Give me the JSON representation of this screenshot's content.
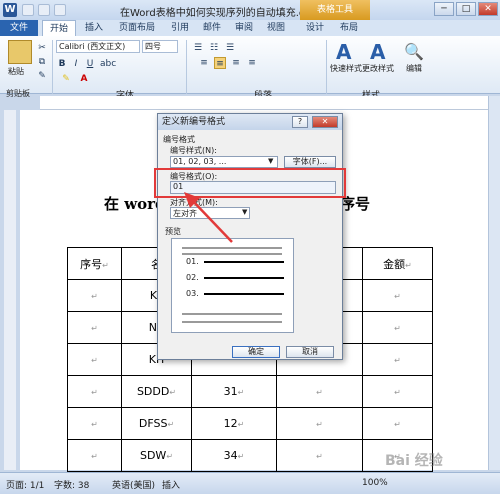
{
  "window": {
    "title": "在Word表格中如何实现序列的自动填充.docx M...",
    "table_tools": "表格工具",
    "min": "─",
    "max": "□",
    "close": "✕"
  },
  "tabs": [
    "文件",
    "开始",
    "插入",
    "页面布局",
    "引用",
    "邮件",
    "审阅",
    "视图",
    "设计",
    "布局"
  ],
  "ribbon": {
    "paste": "粘贴",
    "font_name": "Calibri (西文正文)",
    "font_size": "四号",
    "bold": "B",
    "italic": "I",
    "underline": "U",
    "quick_style": "快速样式",
    "change_style": "更改样式",
    "edit": "编辑",
    "groups": {
      "clipboard": "剪贴板",
      "font": "字体",
      "paragraph": "段落",
      "style": "样式"
    }
  },
  "document": {
    "title_left": "在 word",
    "title_right": "序号",
    "headers": [
      "序号",
      "名",
      "",
      "",
      "金额"
    ],
    "rows": [
      [
        "",
        "KL",
        "",
        "",
        ""
      ],
      [
        "",
        "NK",
        "",
        "",
        ""
      ],
      [
        "",
        "KH",
        "",
        "",
        ""
      ],
      [
        "",
        "SDDD",
        "31",
        "",
        ""
      ],
      [
        "",
        "DFSS",
        "12",
        "",
        ""
      ],
      [
        "",
        "SDW",
        "34",
        "",
        ""
      ]
    ],
    "para_mark": "↵"
  },
  "dialog": {
    "title": "定义新编号格式",
    "help": "?",
    "close": "✕",
    "section_numbering": "编号格式",
    "style_label": "编号样式(N):",
    "style_value": "01, 02, 03, ...",
    "font_button": "字体(F)...",
    "format_label": "编号格式(O):",
    "format_value": "01",
    "align_label": "对齐方式(M):",
    "align_value": "左对齐",
    "preview_label": "预览",
    "preview_items": [
      "01.",
      "02.",
      "03."
    ],
    "ok": "确定",
    "cancel": "取消"
  },
  "status": {
    "page": "页面: 1/1",
    "words": "字数: 38",
    "lang": "英语(美国)",
    "mode": "插入",
    "zoom": "100%"
  },
  "watermark": "Bai 经验",
  "colors": {
    "highlight": "#e23a3a",
    "file_tab": "#2a64b0",
    "table_tools": "#d89a20"
  }
}
